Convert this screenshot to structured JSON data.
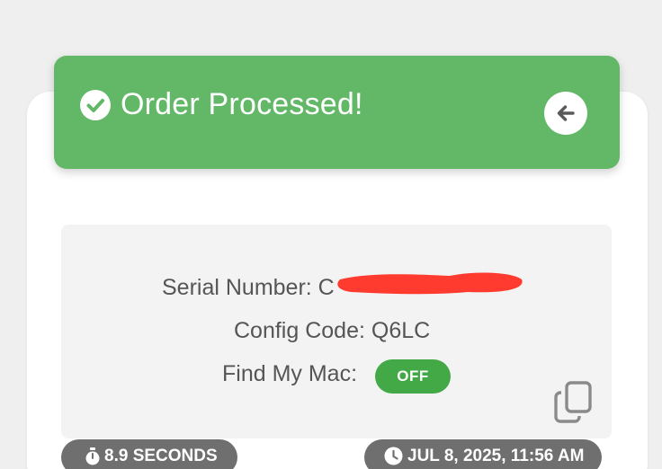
{
  "banner": {
    "title": "Order Processed!",
    "check_icon": "check-circle-icon",
    "back_icon": "arrow-left-icon",
    "color": "#62b866"
  },
  "details": {
    "serial_label": "Serial Number: C",
    "config_label": "Config Code: Q6LC",
    "find_my_mac_label": "Find My Mac:",
    "find_my_mac_status": "OFF",
    "status_color": "#43a947",
    "copy_icon": "copy-icon"
  },
  "footer": {
    "duration": "8.9 SECONDS",
    "duration_icon": "stopwatch-icon",
    "timestamp": "JUL 8, 2025, 11:56 AM",
    "timestamp_icon": "clock-icon"
  }
}
